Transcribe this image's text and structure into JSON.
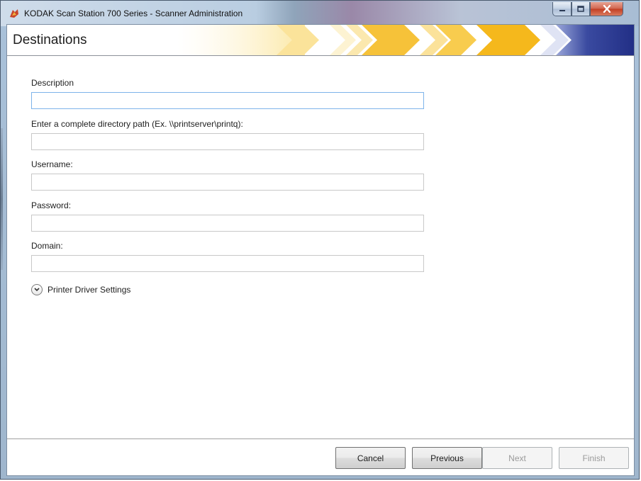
{
  "window": {
    "title": "KODAK Scan Station 700 Series - Scanner Administration",
    "app_icon": "kodak-scanner-icon",
    "controls": {
      "minimize": "minimize-icon",
      "maximize": "maximize-icon",
      "close": "close-icon"
    }
  },
  "header": {
    "title": "Destinations",
    "accent_colors": [
      "#f5b81c",
      "#f9d56a",
      "#2b3a8f"
    ]
  },
  "form": {
    "description": {
      "label": "Description",
      "value": ""
    },
    "directory_path": {
      "label": "Enter a complete directory path (Ex. \\\\printserver\\printq):",
      "value": ""
    },
    "username": {
      "label": "Username:",
      "value": ""
    },
    "password": {
      "label": "Password:",
      "value": ""
    },
    "domain": {
      "label": "Domain:",
      "value": ""
    }
  },
  "expander": {
    "label": "Printer Driver Settings",
    "icon": "chevron-down-icon",
    "expanded": false
  },
  "footer": {
    "cancel": "Cancel",
    "previous": "Previous",
    "next": "Next",
    "finish": "Finish",
    "next_enabled": false,
    "finish_enabled": false
  }
}
